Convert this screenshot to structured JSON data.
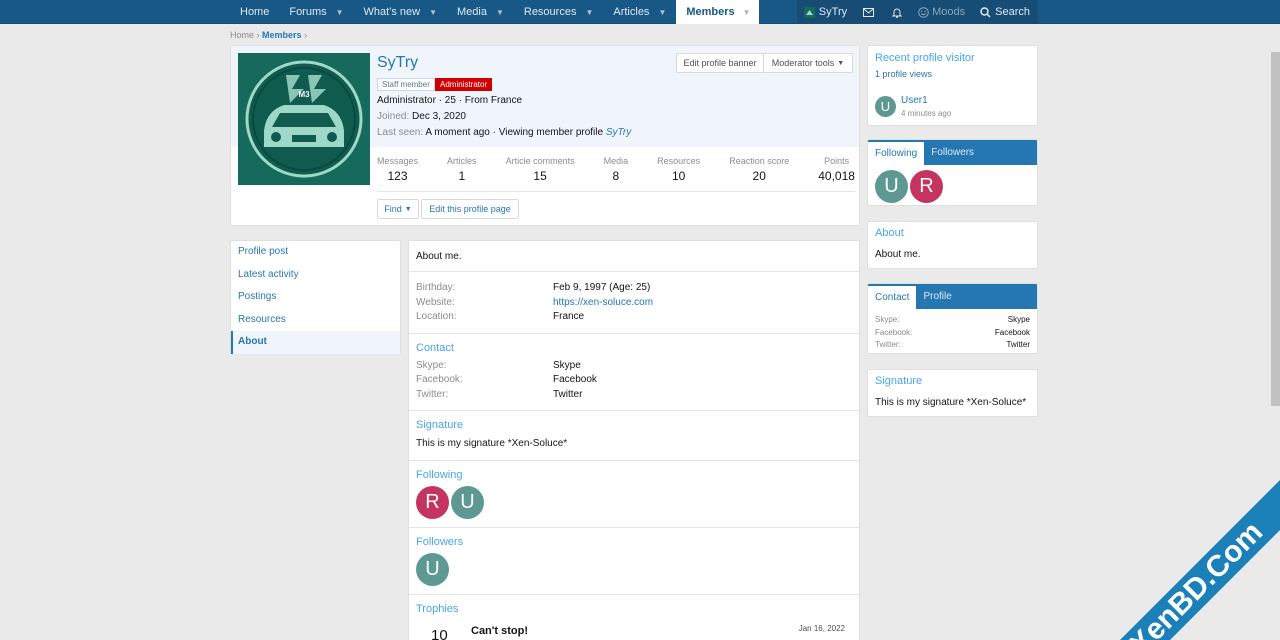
{
  "nav": {
    "items": [
      {
        "label": "Home"
      },
      {
        "label": "Forums"
      },
      {
        "label": "What's new"
      },
      {
        "label": "Media"
      },
      {
        "label": "Resources"
      },
      {
        "label": "Articles"
      },
      {
        "label": "Members"
      }
    ],
    "user": "SyTry",
    "moods": "Moods",
    "search": "Search"
  },
  "breadcrumb": {
    "home": "Home",
    "members": "Members"
  },
  "profile": {
    "name": "SyTry",
    "badge_staff": "Staff member",
    "badge_admin": "Administrator",
    "blurb": "Administrator · 25 · From France",
    "joined_label": "Joined:",
    "joined": "Dec 3, 2020",
    "last_seen_label": "Last seen:",
    "last_seen": "A moment ago · Viewing member profile",
    "last_seen_link": "SyTry",
    "edit_banner": "Edit profile banner",
    "mod_tools": "Moderator tools",
    "find": "Find",
    "edit_profile": "Edit this profile page",
    "avatar_text": "M3",
    "stats": [
      {
        "label": "Messages",
        "value": "123"
      },
      {
        "label": "Articles",
        "value": "1"
      },
      {
        "label": "Article comments",
        "value": "15"
      },
      {
        "label": "Media",
        "value": "8"
      },
      {
        "label": "Resources",
        "value": "10"
      },
      {
        "label": "Reaction score",
        "value": "20"
      },
      {
        "label": "Points",
        "value": "40,018"
      }
    ]
  },
  "tabs": [
    "Profile post",
    "Latest activity",
    "Postings",
    "Resources",
    "About"
  ],
  "about": {
    "intro": "About me.",
    "birthday_label": "Birthday:",
    "birthday": "Feb 9, 1997 (Age: 25)",
    "website_label": "Website:",
    "website": "https://xen-soluce.com",
    "location_label": "Location:",
    "location": "France",
    "contact_title": "Contact",
    "skype_label": "Skype:",
    "skype": "Skype",
    "facebook_label": "Facebook:",
    "facebook": "Facebook",
    "twitter_label": "Twitter:",
    "twitter": "Twitter",
    "signature_title": "Signature",
    "signature": "This is my signature *Xen-Soluce*",
    "following_title": "Following",
    "followers_title": "Followers",
    "trophies_title": "Trophies",
    "trophy_points": "10",
    "trophy_name": "Can't stop!",
    "trophy_date": "Jan 16, 2022"
  },
  "visitors": {
    "title": "Recent profile visitor",
    "views": "1 profile views",
    "user": "User1",
    "time": "4 minutes ago"
  },
  "follow_tabs": {
    "following": "Following",
    "followers": "Followers"
  },
  "side_about": {
    "title": "About",
    "text": "About me."
  },
  "contact_tabs": {
    "contact": "Contact",
    "profile": "Profile"
  },
  "side_signature": {
    "title": "Signature",
    "text": "This is my signature *Xen-Soluce*"
  },
  "avatars": {
    "u": "U",
    "r": "R"
  },
  "watermark": "XenBD.Com",
  "colors": {
    "nav": "#185886",
    "link": "#2577b1",
    "admin_badge": "#d00000",
    "avatar_r": "#c53360",
    "avatar_u": "#5e9893"
  }
}
